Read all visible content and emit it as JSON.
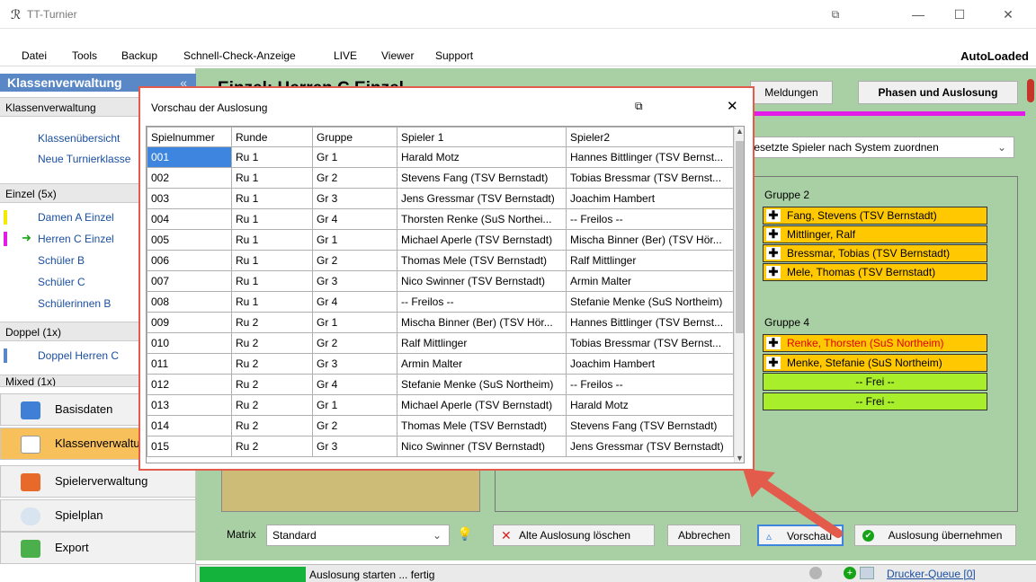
{
  "window": {
    "title": "TT-Turnier",
    "restore_glyph": "⧉",
    "minimize_glyph": "—",
    "maximize_glyph": "☐",
    "close_glyph": "✕"
  },
  "menu": {
    "items": [
      "Datei",
      "Tools",
      "Backup",
      "Schnell-Check-Anzeige",
      "LIVE",
      "Viewer",
      "Support"
    ],
    "right_label": "AutoLoaded"
  },
  "sidebar": {
    "header": "Klassenverwaltung",
    "collapse_glyph": "«",
    "section_klassen": "Klassenverwaltung",
    "klassen_links": [
      "Klassenübersicht",
      "Neue Turnierklasse"
    ],
    "section_einzel": "Einzel (5x)",
    "einzel_items": [
      "Damen A Einzel",
      "Herren C Einzel",
      "Schüler B",
      "Schüler C",
      "Schülerinnen B"
    ],
    "section_doppel": "Doppel (1x)",
    "doppel_items": [
      "Doppel Herren C"
    ],
    "section_mixed": "Mixed (1x)",
    "nav_buttons": [
      "Basisdaten",
      "Klassenverwaltung",
      "Spielerverwaltung",
      "Spielplan",
      "Export"
    ]
  },
  "main": {
    "page_title": "Einzel: Herren C Einzel",
    "tabs": [
      "Meldungen",
      "Phasen und Auslosung"
    ],
    "system_dropdown": "Gesetzte Spieler nach System zuordnen",
    "group2_title": "Gruppe 2",
    "group2_players": [
      "Fang, Stevens (TSV Bernstadt)",
      "Mittlinger, Ralf",
      "Bressmar, Tobias (TSV Bernstadt)",
      "Mele, Thomas (TSV Bernstadt)"
    ],
    "group4_title": "Gruppe 4",
    "group4_players": [
      "Renke, Thorsten (SuS Northeim)",
      "Menke, Stefanie (SuS Northeim)"
    ],
    "frei_label": "-- Frei --",
    "matrix_label": "Matrix",
    "matrix_value": "Standard",
    "btn_delete": "Alte Auslosung löschen",
    "btn_cancel": "Abbrechen",
    "btn_preview": "Vorschau",
    "btn_apply": "Auslosung übernehmen"
  },
  "status": {
    "progress": 1.0,
    "text": "Auslosung starten ... fertig",
    "queue": "Drucker-Queue [0]"
  },
  "dialog": {
    "title": "Vorschau der Auslosung",
    "columns": [
      "Spielnummer",
      "Runde",
      "Gruppe",
      "Spieler 1",
      "Spieler2"
    ],
    "rows": [
      [
        "001",
        "Ru 1",
        "Gr 1",
        "Harald Motz",
        "Hannes Bittlinger (TSV Bernst..."
      ],
      [
        "002",
        "Ru 1",
        "Gr 2",
        "Stevens Fang (TSV Bernstadt)",
        "Tobias Bressmar (TSV Bernst..."
      ],
      [
        "003",
        "Ru 1",
        "Gr 3",
        "Jens Gressmar (TSV Bernstadt)",
        "Joachim Hambert"
      ],
      [
        "004",
        "Ru 1",
        "Gr 4",
        "Thorsten Renke (SuS Northei...",
        "-- Freilos --"
      ],
      [
        "005",
        "Ru 1",
        "Gr 1",
        "Michael Aperle (TSV Bernstadt)",
        "Mischa Binner (Ber) (TSV Hör..."
      ],
      [
        "006",
        "Ru 1",
        "Gr 2",
        "Thomas Mele (TSV Bernstadt)",
        "Ralf Mittlinger"
      ],
      [
        "007",
        "Ru 1",
        "Gr 3",
        "Nico Swinner (TSV Bernstadt)",
        "Armin Malter"
      ],
      [
        "008",
        "Ru 1",
        "Gr 4",
        "-- Freilos --",
        "Stefanie Menke (SuS Northeim)"
      ],
      [
        "009",
        "Ru 2",
        "Gr 1",
        "Mischa Binner (Ber) (TSV Hör...",
        "Hannes Bittlinger (TSV Bernst..."
      ],
      [
        "010",
        "Ru 2",
        "Gr 2",
        "Ralf Mittlinger",
        "Tobias Bressmar (TSV Bernst..."
      ],
      [
        "011",
        "Ru 2",
        "Gr 3",
        "Armin Malter",
        "Joachim Hambert"
      ],
      [
        "012",
        "Ru 2",
        "Gr 4",
        "Stefanie Menke (SuS Northeim)",
        "-- Freilos --"
      ],
      [
        "013",
        "Ru 2",
        "Gr 1",
        "Michael Aperle (TSV Bernstadt)",
        "Harald Motz"
      ],
      [
        "014",
        "Ru 2",
        "Gr 2",
        "Thomas Mele (TSV Bernstadt)",
        "Stevens Fang (TSV Bernstadt)"
      ],
      [
        "015",
        "Ru 2",
        "Gr 3",
        "Nico Swinner (TSV Bernstadt)",
        "Jens Gressmar (TSV Bernstadt)"
      ]
    ]
  },
  "colors": {
    "accent_blue": "#3e85e0",
    "highlight_yellow": "#ffc800",
    "free_green": "#a8ee2a",
    "dialog_border": "#e35b4a",
    "status_green": "#14b33c",
    "magenta_bar": "#e21be8"
  }
}
